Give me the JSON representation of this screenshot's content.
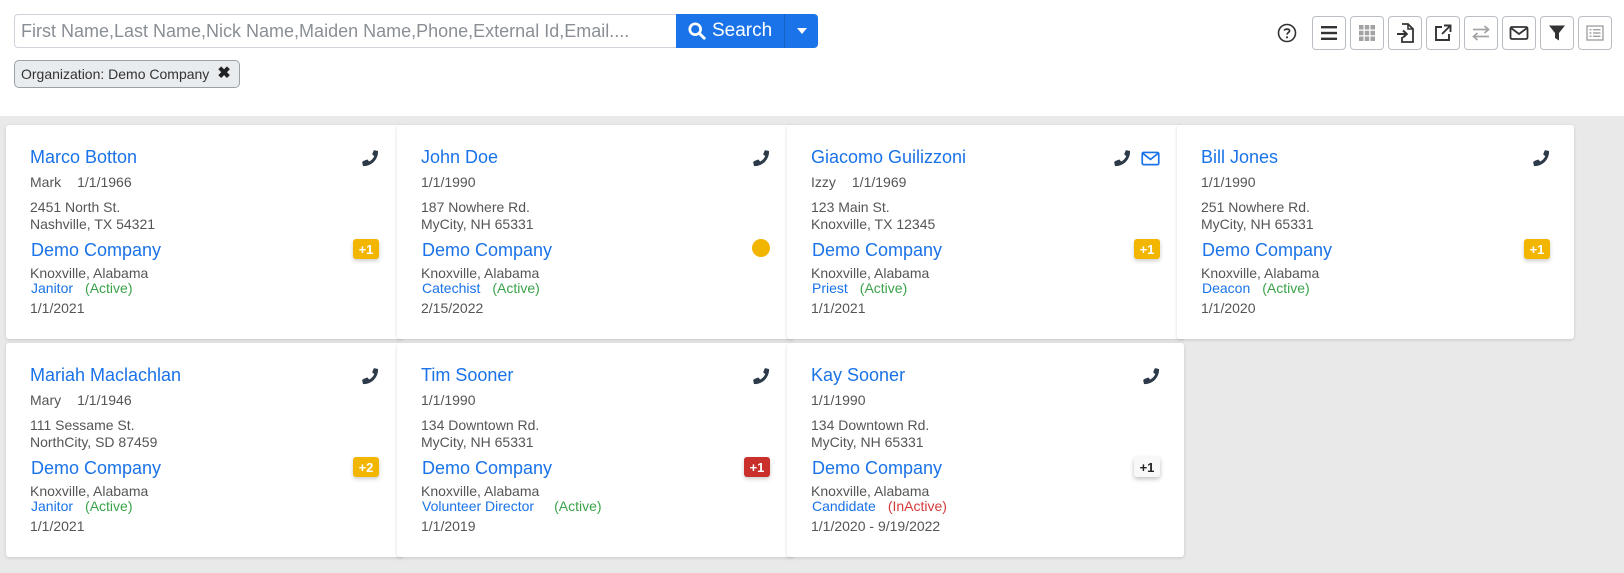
{
  "search": {
    "placeholder": "First Name,Last Name,Nick Name,Maiden Name,Phone,External Id,Email....",
    "button_label": "Search"
  },
  "filter_chip": {
    "label": "Organization: Demo Company",
    "close": "✖"
  },
  "toolbar": {
    "icons": [
      "help-icon",
      "list-view-icon",
      "grid-view-icon",
      "import-icon",
      "export-icon",
      "transfer-icon",
      "email-icon",
      "filter-icon",
      "details-view-icon"
    ]
  },
  "colors": {
    "accent": "#1a73e8",
    "badge_yellow": "#f2b600",
    "badge_red": "#c9302c",
    "active": "#3aa34a",
    "inactive": "#d33a3a"
  },
  "cards": [
    {
      "name": "Marco Botton",
      "nick": "Mark",
      "dob": "1/1/1966",
      "addr1": "2451 North St.",
      "addr2": "Nashville, TX 54321",
      "org": "Demo Company",
      "org_loc": "Knoxville, Alabama",
      "role": "Janitor",
      "status": "(Active)",
      "date": "1/1/2021",
      "badge": "+1",
      "badge_style": "yellow",
      "email": false
    },
    {
      "name": "John Doe",
      "nick": "",
      "dob": "1/1/1990",
      "addr1": "187 Nowhere Rd.",
      "addr2": "MyCity, NH 65331",
      "org": "Demo Company",
      "org_loc": "Knoxville, Alabama",
      "role": "Catechist",
      "status": "(Active)",
      "date": "2/15/2022",
      "badge": "",
      "badge_style": "dot",
      "email": false
    },
    {
      "name": "Giacomo Guilizzoni",
      "nick": "Izzy",
      "dob": "1/1/1969",
      "addr1": "123 Main St.",
      "addr2": "Knoxville, TX 12345",
      "org": "Demo Company",
      "org_loc": "Knoxville, Alabama",
      "role": "Priest",
      "status": "(Active)",
      "date": "1/1/2021",
      "badge": "+1",
      "badge_style": "yellow",
      "email": true
    },
    {
      "name": "Bill Jones",
      "nick": "",
      "dob": "1/1/1990",
      "addr1": "251 Nowhere Rd.",
      "addr2": "MyCity, NH 65331",
      "org": "Demo Company",
      "org_loc": "Knoxville, Alabama",
      "role": "Deacon",
      "status": "(Active)",
      "date": "1/1/2020",
      "badge": "+1",
      "badge_style": "yellow",
      "email": false
    },
    {
      "name": "Mariah Maclachlan",
      "nick": "Mary",
      "dob": "1/1/1946",
      "addr1": "111 Sessame St.",
      "addr2": "NorthCity, SD 87459",
      "org": "Demo Company",
      "org_loc": "Knoxville, Alabama",
      "role": "Janitor",
      "status": "(Active)",
      "date": "1/1/2021",
      "badge": "+2",
      "badge_style": "yellow",
      "email": false
    },
    {
      "name": "Tim Sooner",
      "nick": "",
      "dob": "1/1/1990",
      "addr1": "134 Downtown Rd.",
      "addr2": "MyCity, NH 65331",
      "org": "Demo Company",
      "org_loc": "Knoxville, Alabama",
      "role": "Volunteer Director",
      "status": "(Active)",
      "date": "1/1/2019",
      "badge": "+1",
      "badge_style": "red",
      "email": false
    },
    {
      "name": "Kay Sooner",
      "nick": "",
      "dob": "1/1/1990",
      "addr1": "134 Downtown Rd.",
      "addr2": "MyCity, NH 65331",
      "org": "Demo Company",
      "org_loc": "Knoxville, Alabama",
      "role": "Candidate",
      "status": "(InActive)",
      "date": "1/1/2020 - 9/19/2022",
      "badge": "+1",
      "badge_style": "plain",
      "email": false
    }
  ]
}
